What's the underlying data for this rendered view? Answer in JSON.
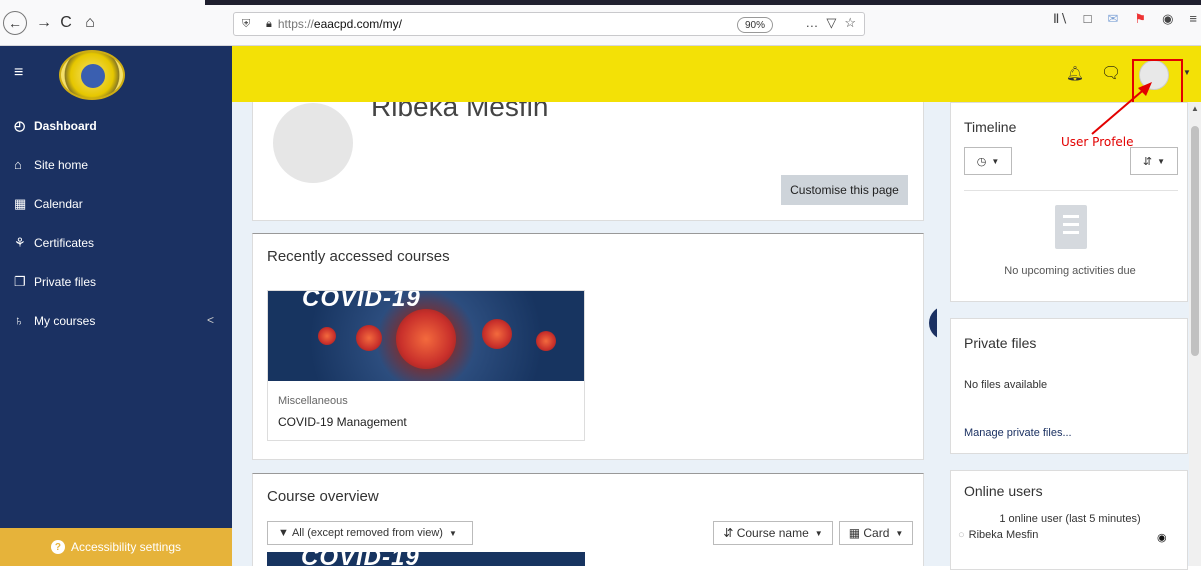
{
  "browser": {
    "url_proto": "https://",
    "url_host": "eaacpd.com/my/",
    "zoom": "90%",
    "url_menu": "…",
    "pocket_icon": "pocket-icon",
    "star_icon": "bookmark-star-icon",
    "back_glyph": "←",
    "forward_glyph": "→",
    "reload_glyph": "C",
    "home_glyph": "⌂"
  },
  "header": {
    "menu_glyph": "≡",
    "bell_glyph": "⭘",
    "chat_glyph": "●"
  },
  "sidebar": {
    "items": [
      {
        "label": "Dashboard",
        "icon": "◴"
      },
      {
        "label": "Site home",
        "icon": "⌂"
      },
      {
        "label": "Calendar",
        "icon": "▦"
      },
      {
        "label": "Certificates",
        "icon": "⚘"
      },
      {
        "label": "Private files",
        "icon": "❐"
      },
      {
        "label": "My courses",
        "icon": "♄"
      }
    ],
    "collapse_glyph": "<",
    "accessibility": "Accessibility settings",
    "accessibility_icon": "?"
  },
  "profile": {
    "name": "Ribeka Mesfin",
    "customise": "Customise this page"
  },
  "recent": {
    "title": "Recently accessed courses",
    "course_image_text": "COVID-19",
    "category": "Miscellaneous",
    "course_name": "COVID-19 Management"
  },
  "overview": {
    "title": "Course overview",
    "filter": "All (except removed from view)",
    "sort": "Course name",
    "view": "Card",
    "image_text": "COVID-19"
  },
  "timeline": {
    "title": "Timeline",
    "empty": "No upcoming activities due"
  },
  "private_files": {
    "title": "Private files",
    "none": "No files available",
    "manage": "Manage private files..."
  },
  "online_users": {
    "title": "Online users",
    "count": "1 online user (last 5 minutes)",
    "user": "Ribeka Mesfin"
  },
  "annotation": {
    "label": "User Profele"
  },
  "colors": {
    "navbar": "#f3e106",
    "sidebar": "#1b3162",
    "accessibility": "#e6b33a",
    "annotation": "#e20000"
  }
}
